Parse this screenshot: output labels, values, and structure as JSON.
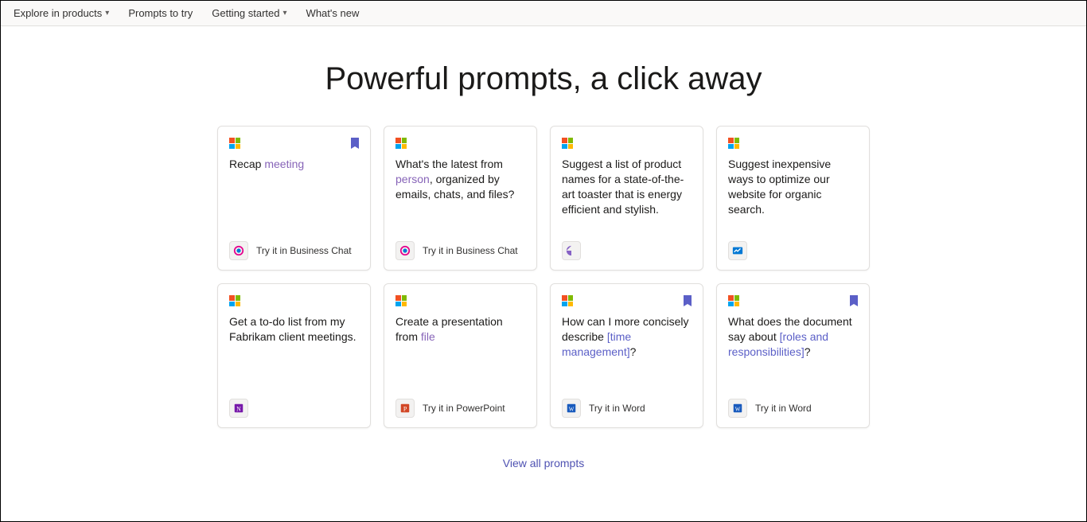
{
  "nav": {
    "explore": "Explore in products",
    "prompts": "Prompts to try",
    "getting_started": "Getting started",
    "whats_new": "What's new"
  },
  "hero": "Powerful prompts, a click away",
  "cards": [
    {
      "prefix": "Recap ",
      "highlight": "meeting",
      "suffix": "",
      "hl_class": "hl",
      "cta": "Try it in Business Chat",
      "icon": "copilot",
      "bookmarked": true
    },
    {
      "prefix": "What's the latest from ",
      "highlight": "person",
      "suffix": ", organized by emails, chats, and files?",
      "hl_class": "hl",
      "cta": "Try it in Business Chat",
      "icon": "copilot",
      "bookmarked": false
    },
    {
      "prefix": "Suggest a list of product names for a state-of-the-art toaster that is energy efficient and stylish.",
      "highlight": "",
      "suffix": "",
      "hl_class": "",
      "cta": "",
      "icon": "loop",
      "bookmarked": false
    },
    {
      "prefix": "Suggest inexpensive ways to optimize our website for organic search.",
      "highlight": "",
      "suffix": "",
      "hl_class": "",
      "cta": "",
      "icon": "whiteboard",
      "bookmarked": false
    },
    {
      "prefix": "Get a to-do list from my Fabrikam client meetings.",
      "highlight": "",
      "suffix": "",
      "hl_class": "",
      "cta": "",
      "icon": "onenote",
      "bookmarked": false
    },
    {
      "prefix": "Create a presentation from ",
      "highlight": "file",
      "suffix": "",
      "hl_class": "hl",
      "cta": "Try it in PowerPoint",
      "icon": "powerpoint",
      "bookmarked": false
    },
    {
      "prefix": "How can I more concisely describe ",
      "highlight": "[time management]",
      "suffix": "?",
      "hl_class": "hl2",
      "cta": "Try it in Word",
      "icon": "word",
      "bookmarked": true
    },
    {
      "prefix": "What does the document say about ",
      "highlight": "[roles and responsibilities]",
      "suffix": "?",
      "hl_class": "hl2",
      "cta": "Try it in Word",
      "icon": "word",
      "bookmarked": true
    }
  ],
  "view_all": "View all prompts"
}
